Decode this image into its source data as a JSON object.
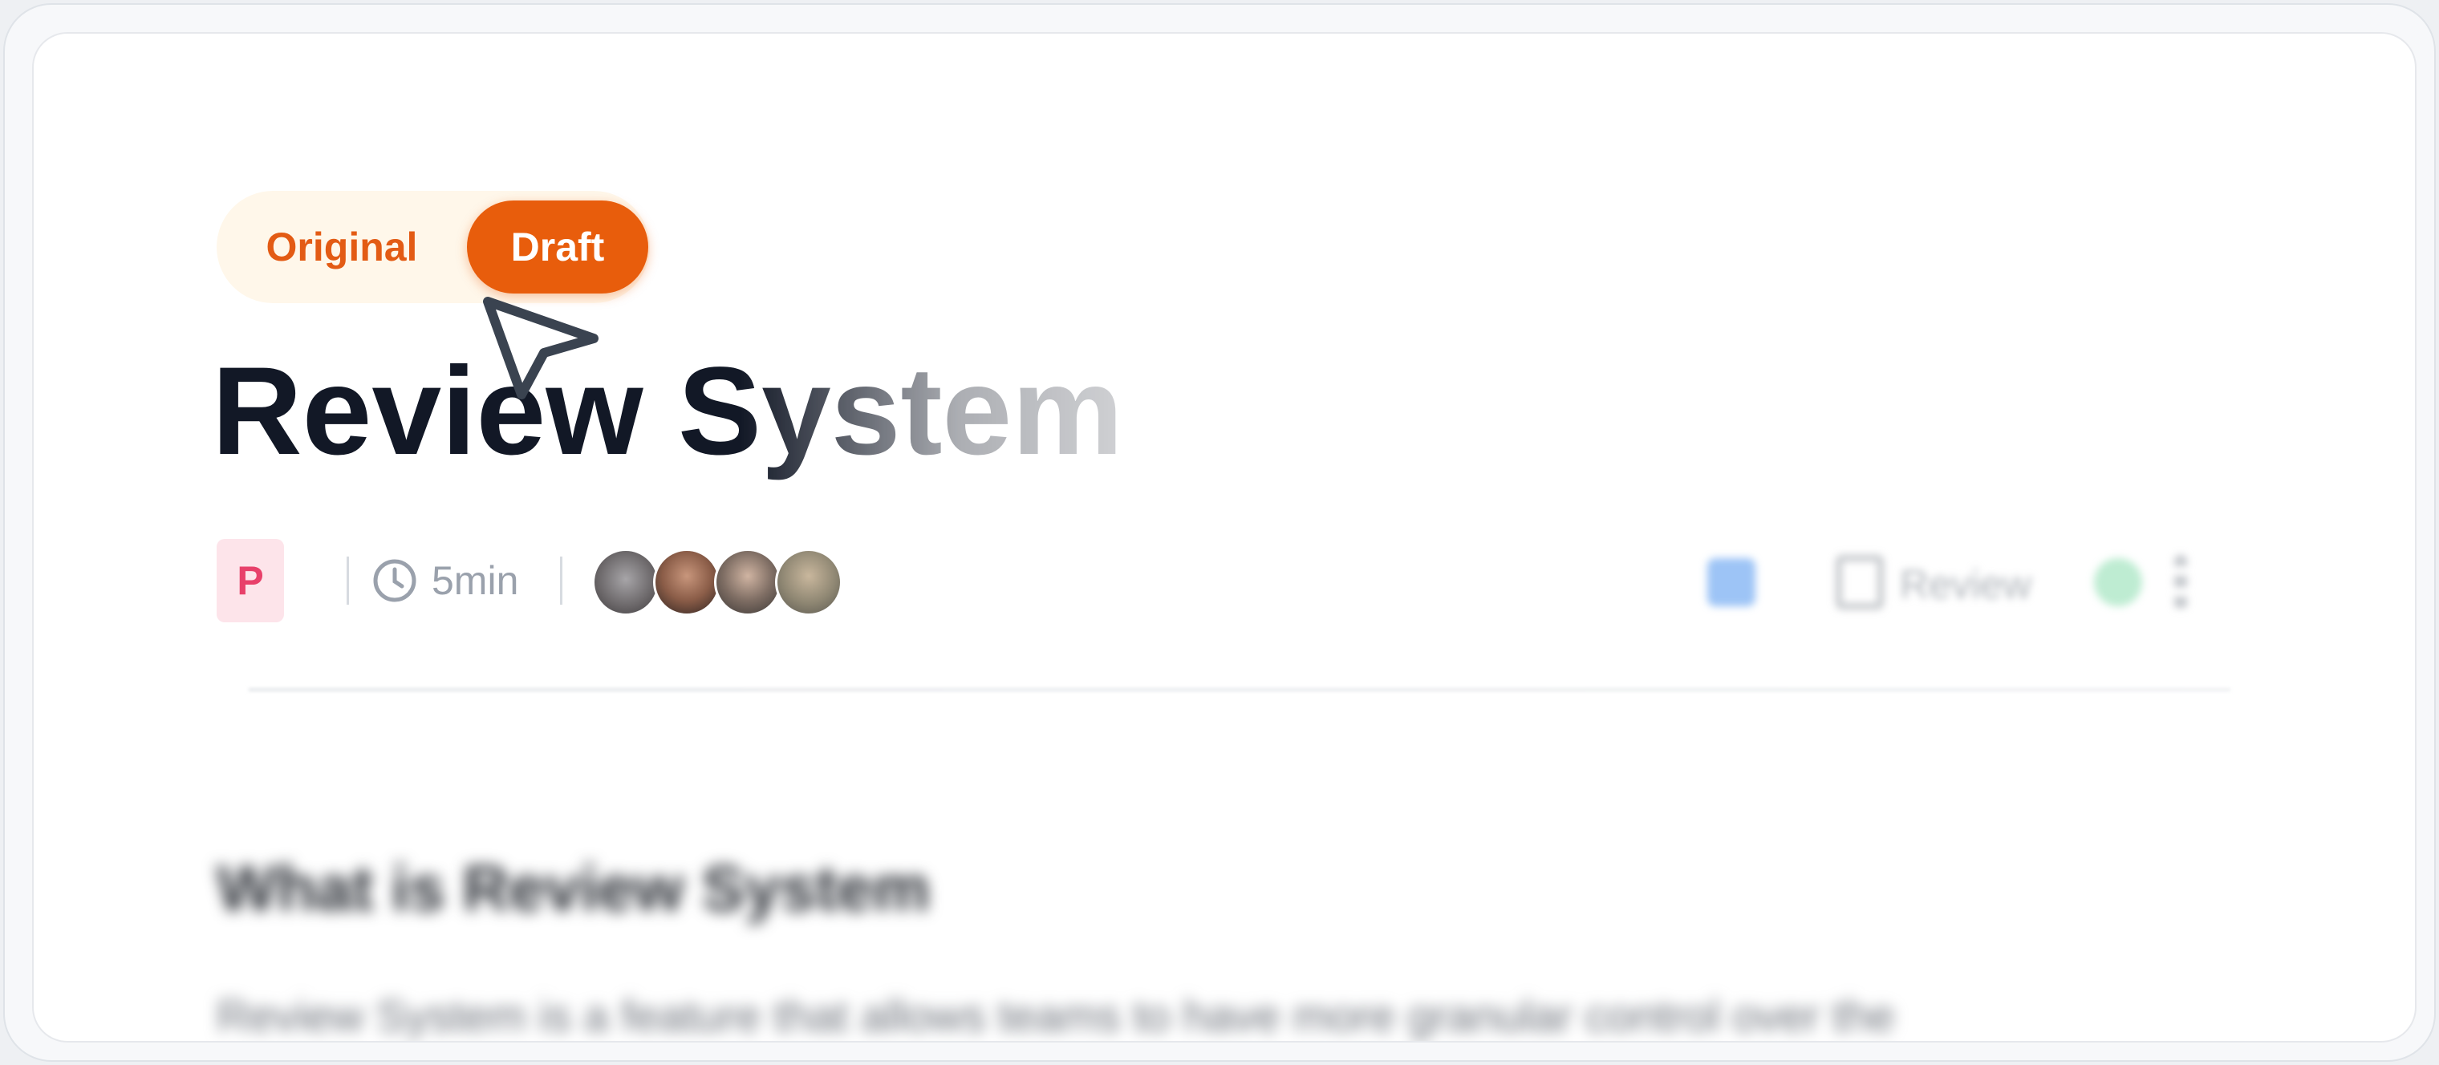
{
  "toggle": {
    "original_label": "Original",
    "draft_label": "Draft",
    "active": "Draft"
  },
  "document": {
    "title": "Review System",
    "category_badge": "P",
    "read_time": "5min",
    "reviewers_count": 4,
    "review_button_label": "Review",
    "section_heading": "What is Review System",
    "body_line_1": "Review System is a feature that allows teams to have more granular control over the"
  },
  "colors": {
    "accent": "#e85d0c",
    "accent_soft": "#fff7ea",
    "badge_bg": "#fde4ea",
    "badge_text": "#e8406a",
    "title": "#121826"
  },
  "icons": {
    "cursor": "pointer-cursor-icon",
    "time": "clock-icon",
    "check": "checkbox-icon",
    "review": "document-review-icon",
    "status": "status-dot-icon",
    "more": "more-vertical-icon"
  }
}
